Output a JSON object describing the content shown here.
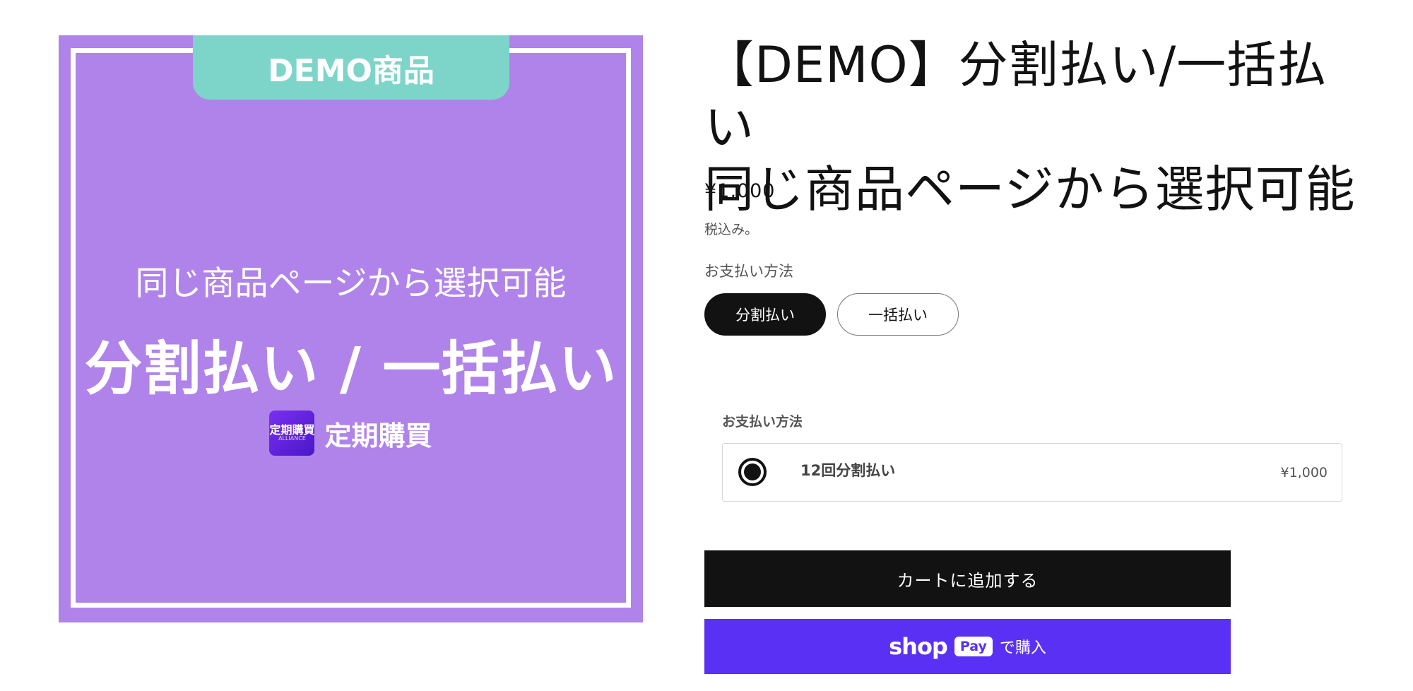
{
  "product_image": {
    "tab_label": "DEMO商品",
    "subline": "同じ商品ページから選択可能",
    "headline": "分割払い / 一括払い",
    "brand_logo_text": "定期購買",
    "brand_logo_subtext": "ALLIANCE",
    "brand_name": "定期購買",
    "background_color": "#b083ea",
    "tab_color": "#7dd5c9"
  },
  "product": {
    "title_line1": "【DEMO】分割払い/一括払い",
    "title_line2": "同じ商品ページから選択可能",
    "price": "¥1,000",
    "tax_note": "税込み。"
  },
  "options": {
    "label": "お支払い方法",
    "choices": [
      {
        "label": "分割払い",
        "selected": true
      },
      {
        "label": "一括払い",
        "selected": false
      }
    ]
  },
  "plan": {
    "heading": "お支払い方法",
    "name": "12回分割払い",
    "price": "¥1,000",
    "selected": true
  },
  "actions": {
    "add_to_cart": "カートに追加する",
    "shop_pay_word": "shop",
    "shop_pay_badge": "Pay",
    "shop_pay_suffix": "で購入",
    "shop_pay_color": "#5a31f4"
  }
}
